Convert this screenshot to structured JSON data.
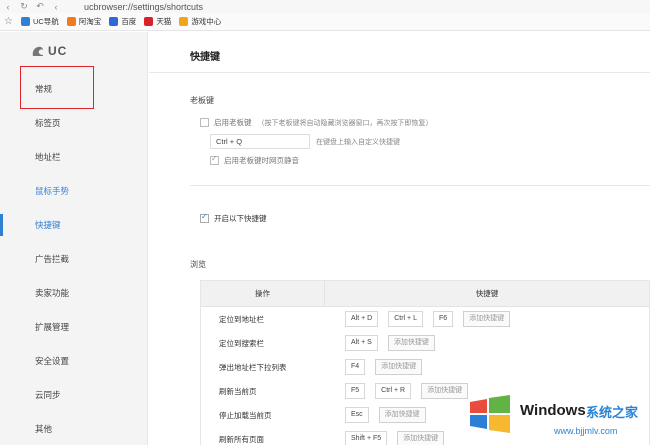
{
  "browser": {
    "url": "ucbrowser://settings/shortcuts",
    "bookmarks": [
      {
        "label": "UC导航",
        "color": "#2f7fd5"
      },
      {
        "label": "阿淘宝",
        "color": "#f07c1b"
      },
      {
        "label": "百度",
        "color": "#3066d8"
      },
      {
        "label": "天猫",
        "color": "#d8222a"
      },
      {
        "label": "游戏中心",
        "color": "#f1a51b"
      }
    ]
  },
  "sidebar": {
    "logo": "UC",
    "items": [
      {
        "label": "常规"
      },
      {
        "label": "标签页"
      },
      {
        "label": "地址栏"
      },
      {
        "label": "鼠标手势"
      },
      {
        "label": "快捷键"
      },
      {
        "label": "广告拦截"
      },
      {
        "label": "卖家功能"
      },
      {
        "label": "扩展管理"
      },
      {
        "label": "安全设置"
      },
      {
        "label": "云同步"
      },
      {
        "label": "其他"
      }
    ]
  },
  "main": {
    "title": "快捷键",
    "boss_key": {
      "section": "老板键",
      "enable_label": "启用老板键",
      "enable_hint": "（按下老板键将自动隐藏浏览器窗口，再次按下即恢复）",
      "key_value": "Ctrl + Q",
      "key_hint": "在键盘上输入自定义快捷键",
      "mute_label": "启用老板键时网页静音"
    },
    "enable_shortcuts_label": "开启以下快捷键",
    "browse_section": "浏览",
    "table": {
      "col_operation": "操作",
      "col_shortcut": "快捷键",
      "add_label": "添加快捷键",
      "rows": [
        {
          "op": "定位到地址栏",
          "keys": [
            "Alt + D",
            "Ctrl + L",
            "F6"
          ]
        },
        {
          "op": "定位到搜索栏",
          "keys": [
            "Alt + S"
          ]
        },
        {
          "op": "弹出地址栏下拉列表",
          "keys": [
            "F4"
          ]
        },
        {
          "op": "刷新当前页",
          "keys": [
            "F5",
            "Ctrl + R"
          ]
        },
        {
          "op": "停止加载当前页",
          "keys": [
            "Esc"
          ]
        },
        {
          "op": "刷新所有页面",
          "keys": [
            "Shift + F5"
          ]
        }
      ]
    }
  },
  "watermark": {
    "brand": "Windows",
    "site": "系统之家",
    "url": "www.bjjmlv.com"
  }
}
